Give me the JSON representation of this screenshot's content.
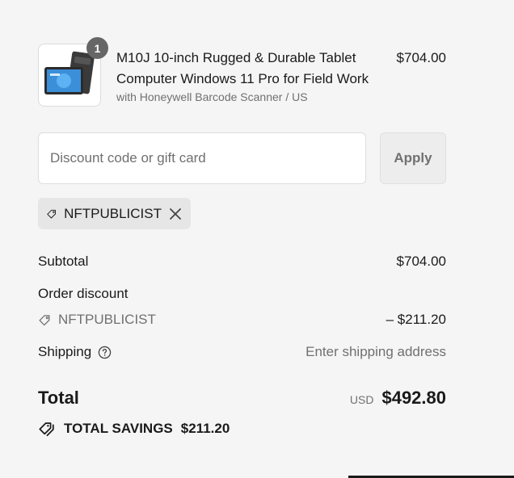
{
  "product": {
    "quantity": "1",
    "title": "M10J 10-inch Rugged & Durable Tablet Computer Windows 11 Pro for Field Work",
    "variant": "with Honeywell Barcode Scanner / US",
    "price": "$704.00"
  },
  "discount": {
    "placeholder": "Discount code or gift card",
    "apply_label": "Apply",
    "applied_code": "NFTPUBLICIST"
  },
  "summary": {
    "subtotal_label": "Subtotal",
    "subtotal_value": "$704.00",
    "order_discount_label": "Order discount",
    "discount_code": "NFTPUBLICIST",
    "discount_value": "– $211.20",
    "shipping_label": "Shipping",
    "shipping_value": "Enter shipping address",
    "total_label": "Total",
    "currency": "USD",
    "total_value": "$492.80",
    "savings_label": "TOTAL SAVINGS",
    "savings_value": "$211.20"
  },
  "icons": {
    "tag": "tag-icon",
    "close": "close-icon",
    "help": "help-circle-icon",
    "savings": "double-tag-icon"
  },
  "colors": {
    "background": "#f5f5f5",
    "badge": "#666666",
    "muted_text": "#707070",
    "chip_bg": "#e6e6e6"
  }
}
